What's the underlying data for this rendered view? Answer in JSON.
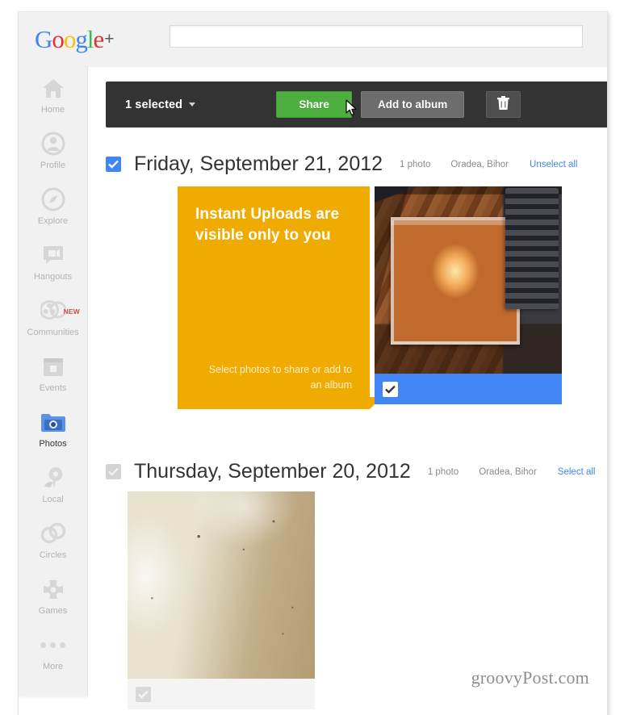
{
  "header": {
    "logo_text": "Google",
    "logo_plus": "+",
    "search_placeholder": "",
    "search_value": ""
  },
  "sidebar": {
    "items": [
      {
        "label": "Home",
        "icon": "home-icon",
        "active": false,
        "badge": ""
      },
      {
        "label": "Profile",
        "icon": "profile-icon",
        "active": false,
        "badge": ""
      },
      {
        "label": "Explore",
        "icon": "explore-icon",
        "active": false,
        "badge": ""
      },
      {
        "label": "Hangouts",
        "icon": "hangouts-icon",
        "active": false,
        "badge": ""
      },
      {
        "label": "Communities",
        "icon": "communities-icon",
        "active": false,
        "badge": "NEW"
      },
      {
        "label": "Events",
        "icon": "events-icon",
        "active": false,
        "badge": ""
      },
      {
        "label": "Photos",
        "icon": "photos-icon",
        "active": true,
        "badge": ""
      },
      {
        "label": "Local",
        "icon": "local-icon",
        "active": false,
        "badge": ""
      },
      {
        "label": "Circles",
        "icon": "circles-icon",
        "active": false,
        "badge": ""
      },
      {
        "label": "Games",
        "icon": "games-icon",
        "active": false,
        "badge": ""
      },
      {
        "label": "More",
        "icon": "more-dots-icon",
        "active": false,
        "badge": ""
      }
    ]
  },
  "toolbar": {
    "selected_label": "1 selected",
    "share_label": "Share",
    "add_to_album_label": "Add to album",
    "delete_icon": "trash-icon",
    "share_color": "#4caf3f",
    "bar_color": "#333333"
  },
  "groups": [
    {
      "date": "Friday, September 21, 2012",
      "photo_count": "1 photo",
      "location": "Oradea, Bihor",
      "select_action": "Unselect all",
      "checked": true,
      "promo": {
        "title": "Instant Uploads are visible only to you",
        "footer": "Select photos to share or add to an album",
        "color": "#f0ab00"
      },
      "photos": [
        {
          "name": "cd-case-photo",
          "selected": true
        }
      ]
    },
    {
      "date": "Thursday, September 20, 2012",
      "photo_count": "1 photo",
      "location": "Oradea, Bihor",
      "select_action": "Select all",
      "checked": false,
      "photos": [
        {
          "name": "foam-photo",
          "selected": false
        }
      ]
    }
  ],
  "watermark": "groovyPost.com",
  "colors": {
    "accent_blue": "#4285f4",
    "link_blue": "#4285f4",
    "promo_orange": "#f0ab00",
    "toolbar_dark": "#333333"
  }
}
